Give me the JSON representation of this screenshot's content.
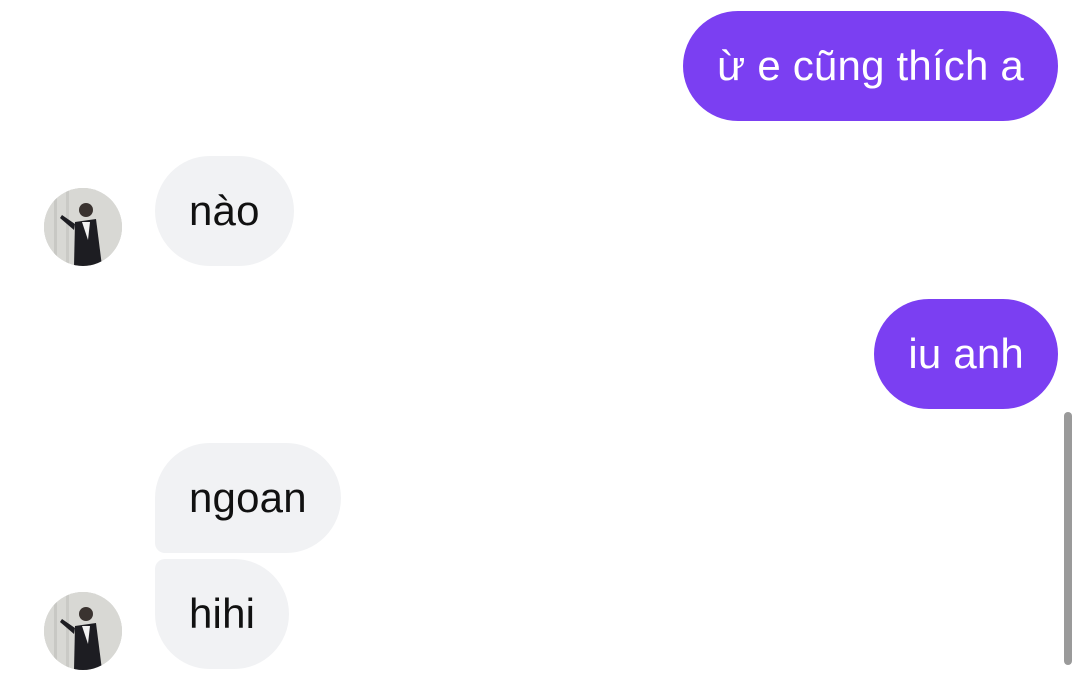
{
  "messages": [
    {
      "from": "me",
      "text": "ừ e cũng thích a"
    },
    {
      "from": "them",
      "text": "nào"
    },
    {
      "from": "me",
      "text": "iu anh"
    },
    {
      "from": "them",
      "text": "ngoan"
    },
    {
      "from": "them",
      "text": "hihi"
    }
  ],
  "colors": {
    "sent_bubble": "#7b3ff2",
    "received_bubble": "#f1f2f4",
    "sent_text": "#ffffff",
    "received_text": "#111111"
  },
  "icons": {
    "avatar": "contact-avatar-photo"
  }
}
